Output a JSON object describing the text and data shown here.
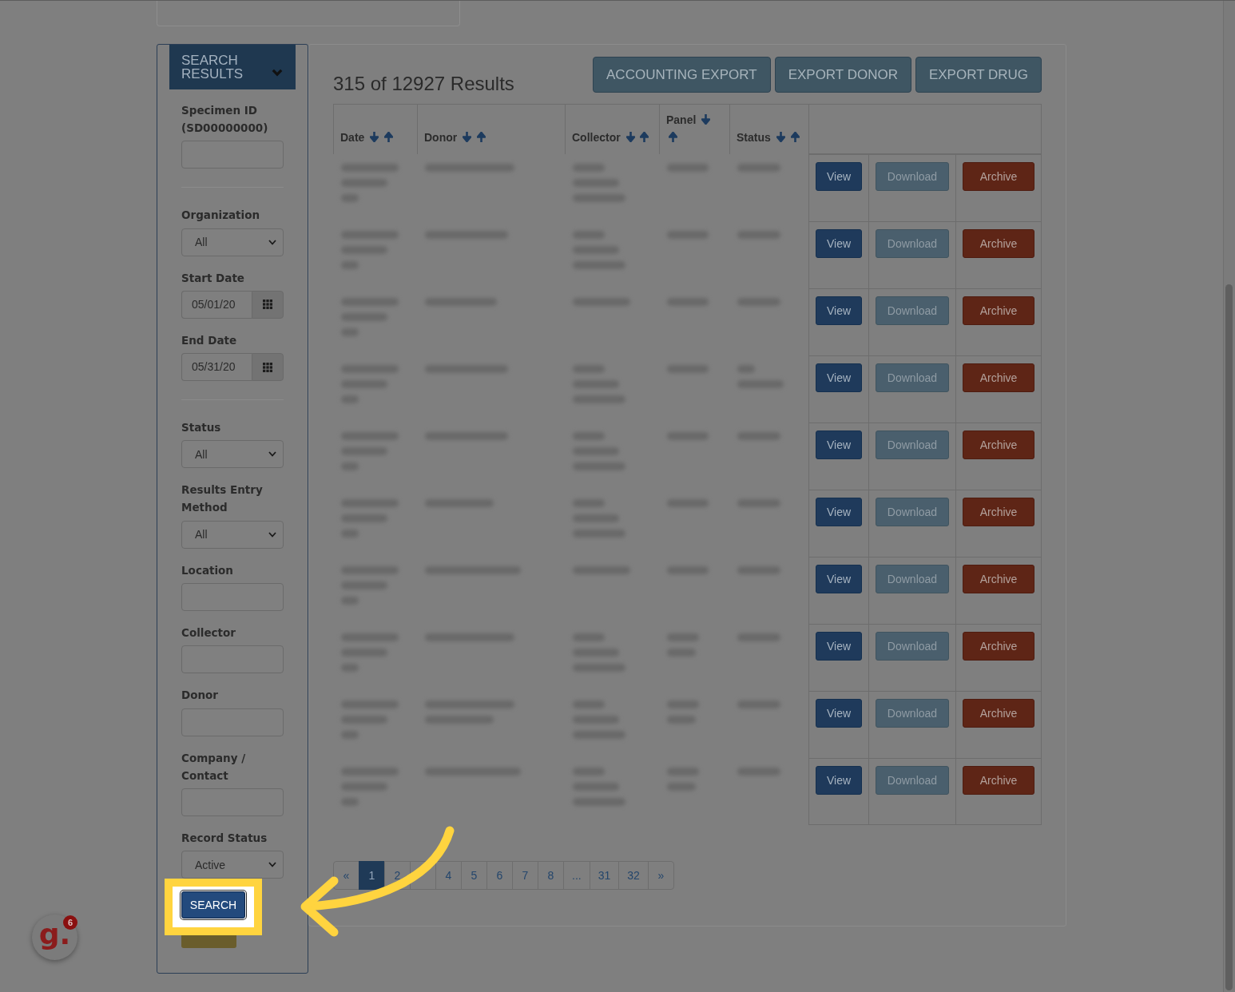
{
  "sidebar": {
    "title": "SEARCH RESULTS",
    "fields": [
      {
        "kind": "text",
        "label": "Specimen ID (SD00000000)"
      },
      {
        "kind": "divider"
      },
      {
        "kind": "select",
        "label": "Organization",
        "value": "All"
      },
      {
        "kind": "date",
        "label": "Start Date",
        "value": "05/01/20"
      },
      {
        "kind": "date",
        "label": "End Date",
        "value": "05/31/20"
      },
      {
        "kind": "divider"
      },
      {
        "kind": "select",
        "label": "Status",
        "value": "All"
      },
      {
        "kind": "select",
        "label": "Results Entry Method",
        "value": "All"
      },
      {
        "kind": "text",
        "label": "Location"
      },
      {
        "kind": "text",
        "label": "Collector"
      },
      {
        "kind": "text",
        "label": "Donor"
      },
      {
        "kind": "text",
        "label": "Company / Contact"
      },
      {
        "kind": "select",
        "label": "Record Status",
        "value": "Active"
      }
    ],
    "buttons": [
      {
        "kind": "search",
        "label": "SEARCH",
        "highlighted": true
      },
      {
        "kind": "reset",
        "highlighted": false
      }
    ]
  },
  "results": {
    "title": "315 of 12927 Results",
    "exports": [
      "ACCOUNTING EXPORT",
      "EXPORT DONOR",
      "EXPORT DRUG"
    ],
    "columns": [
      "Date",
      "Donor",
      "Collector",
      "Panel",
      "Status"
    ],
    "rows": [
      {
        "actions": [
          {
            "kind": "view",
            "label": "View"
          },
          {
            "kind": "download",
            "label": "Download"
          },
          {
            "kind": "archive",
            "label": "Archive"
          }
        ]
      },
      {
        "actions": [
          {
            "kind": "view",
            "label": "View"
          },
          {
            "kind": "download",
            "label": "Download"
          },
          {
            "kind": "archive",
            "label": "Archive"
          }
        ]
      },
      {
        "actions": [
          {
            "kind": "view",
            "label": "View"
          },
          {
            "kind": "download",
            "label": "Download"
          },
          {
            "kind": "archive",
            "label": "Archive"
          }
        ]
      },
      {
        "actions": [
          {
            "kind": "view",
            "label": "View"
          },
          {
            "kind": "download",
            "label": "Download"
          },
          {
            "kind": "archive",
            "label": "Archive"
          }
        ]
      },
      {
        "actions": [
          {
            "kind": "view",
            "label": "View"
          },
          {
            "kind": "download",
            "label": "Download"
          },
          {
            "kind": "archive",
            "label": "Archive"
          }
        ]
      },
      {
        "actions": [
          {
            "kind": "view",
            "label": "View"
          },
          {
            "kind": "download",
            "label": "Download"
          },
          {
            "kind": "archive",
            "label": "Archive"
          }
        ]
      },
      {
        "actions": [
          {
            "kind": "view",
            "label": "View"
          },
          {
            "kind": "download",
            "label": "Download"
          },
          {
            "kind": "archive",
            "label": "Archive"
          }
        ]
      },
      {
        "actions": [
          {
            "kind": "view",
            "label": "View"
          },
          {
            "kind": "download",
            "label": "Download"
          },
          {
            "kind": "archive",
            "label": "Archive"
          }
        ]
      },
      {
        "actions": [
          {
            "kind": "view",
            "label": "View"
          },
          {
            "kind": "download",
            "label": "Download"
          },
          {
            "kind": "archive",
            "label": "Archive"
          }
        ]
      },
      {
        "actions": [
          {
            "kind": "view",
            "label": "View"
          },
          {
            "kind": "download",
            "label": "Download"
          },
          {
            "kind": "archive",
            "label": "Archive"
          }
        ]
      }
    ],
    "pagination": [
      {
        "label": "«",
        "selected": false
      },
      {
        "label": "1",
        "selected": true
      },
      {
        "label": "2",
        "selected": false
      },
      {
        "selected": false
      },
      {
        "label": "4",
        "selected": false
      },
      {
        "label": "5",
        "selected": false
      },
      {
        "label": "6",
        "selected": false
      },
      {
        "label": "7",
        "selected": false
      },
      {
        "label": "8",
        "selected": false
      },
      {
        "label": "...",
        "selected": false
      },
      {
        "label": "31",
        "selected": false
      },
      {
        "label": "32",
        "selected": false
      },
      {
        "label": "»",
        "selected": false
      }
    ]
  },
  "launcher": {
    "label": "g.",
    "badge": "6"
  }
}
